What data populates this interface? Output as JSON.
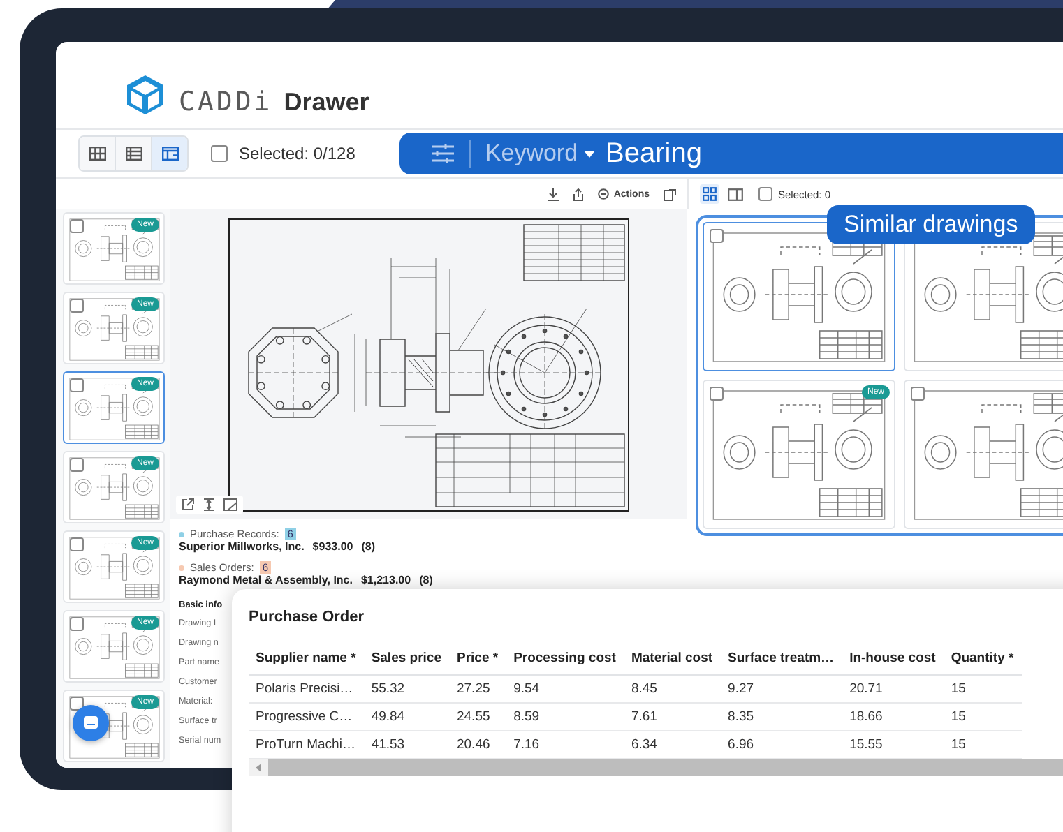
{
  "logo": {
    "mark": "CADDi",
    "product": "Drawer"
  },
  "view_modes": [
    {
      "kind": "grid",
      "selected": false
    },
    {
      "kind": "list",
      "selected": false
    },
    {
      "kind": "split",
      "selected": true
    }
  ],
  "selection": {
    "checked": false,
    "label": "Selected: 0/128"
  },
  "search": {
    "field": "Keyword",
    "value": "Bearing"
  },
  "preview_toolbar": {
    "actions_label": "Actions"
  },
  "thumbnails": [
    {
      "badge": "New",
      "checked": false,
      "selected": false
    },
    {
      "badge": "New",
      "checked": false,
      "selected": false
    },
    {
      "badge": "New",
      "checked": false,
      "selected": true
    },
    {
      "badge": "New",
      "checked": false,
      "selected": false
    },
    {
      "badge": "New",
      "checked": false,
      "selected": false
    },
    {
      "badge": "New",
      "checked": false,
      "selected": false
    },
    {
      "badge": "New",
      "checked": false,
      "selected": false
    }
  ],
  "records": [
    {
      "label": "Purchase Records:",
      "count": "6",
      "color": "#8fd0e6",
      "company": "Superior Millworks, Inc.",
      "amount": "$933.00",
      "quantity": "(8)"
    },
    {
      "label": "Sales Orders:",
      "count": "6",
      "color": "#f6c9b1",
      "company": "Raymond Metal & Assembly, Inc.",
      "amount": "$1,213.00",
      "quantity": "(8)"
    }
  ],
  "basic_info": {
    "title": "Basic info",
    "fields": [
      "Drawing I",
      "Drawing n",
      "Part name",
      "Customer",
      "Material:",
      "Surface tr",
      "Serial num"
    ]
  },
  "similar_panel": {
    "view_modes": [
      {
        "kind": "grid",
        "selected": true
      },
      {
        "kind": "panel",
        "selected": false
      }
    ],
    "selection": {
      "checked": false,
      "label": "Selected: 0"
    },
    "title": "Similar drawings",
    "drawings": [
      {
        "checked": false,
        "selected": true
      },
      {
        "selected": false
      },
      {
        "checked": false,
        "selected": false,
        "badge": "New"
      },
      {
        "checked": false,
        "selected": false
      }
    ]
  },
  "purchase_order": {
    "title": "Purchase Order",
    "columns": [
      "Supplier name *",
      "Sales price",
      "Price *",
      "Processing cost",
      "Material cost",
      "Surface treatm…",
      "In-house cost",
      "Quantity *"
    ],
    "rows": [
      [
        "Polaris Precisi…",
        "55.32",
        "27.25",
        "9.54",
        "8.45",
        "9.27",
        "20.71",
        "15"
      ],
      [
        "Progressive C…",
        "49.84",
        "24.55",
        "8.59",
        "7.61",
        "8.35",
        "18.66",
        "15"
      ],
      [
        "ProTurn Machi…",
        "41.53",
        "20.46",
        "7.16",
        "6.34",
        "6.96",
        "15.55",
        "15"
      ]
    ]
  }
}
